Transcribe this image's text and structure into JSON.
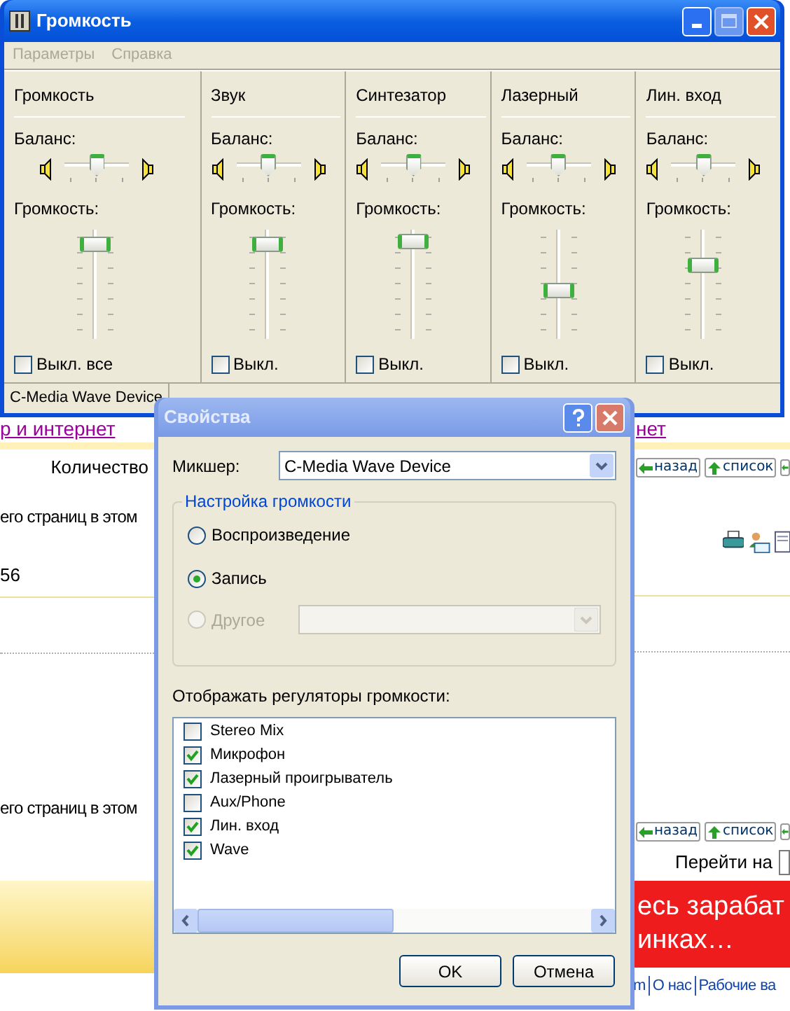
{
  "web_page": {
    "link_left": "р и интернет",
    "link_right": "нет",
    "count_label": "Количество",
    "pages_text_top": "его страниц в этом",
    "number": "56",
    "pages_text_bottom": "его страниц в этом",
    "nav_top": [
      "назад",
      "список"
    ],
    "nav_bottom": [
      "назад",
      "список"
    ],
    "goto_label": "Перейти на",
    "banner_lines": [
      "есь зарабат",
      "инках…"
    ],
    "footer_links": [
      "m",
      "О нас",
      "Рабочие ва"
    ]
  },
  "mixer_window": {
    "title": "Громкость",
    "menu": [
      "Параметры",
      "Справка"
    ],
    "channels": [
      {
        "name": "Громкость",
        "balance_label": "Баланс:",
        "balance": {
          "level": 0.5
        },
        "volume_label": "Громкость:",
        "volume": {
          "level": 0.93
        },
        "mute": {
          "label": "Выкл. все",
          "checked": false
        }
      },
      {
        "name": "Звук",
        "balance_label": "Баланс:",
        "balance": {
          "level": 0.5
        },
        "volume_label": "Громкость:",
        "volume": {
          "level": 0.93
        },
        "mute": {
          "label": "Выкл.",
          "checked": false
        }
      },
      {
        "name": "Синтезатор",
        "balance_label": "Баланс:",
        "balance": {
          "level": 0.5
        },
        "volume_label": "Громкость:",
        "volume": {
          "level": 0.96
        },
        "mute": {
          "label": "Выкл.",
          "checked": false
        }
      },
      {
        "name": "Лазерный",
        "balance_label": "Баланс:",
        "balance": {
          "level": 0.5
        },
        "volume_label": "Громкость:",
        "volume": {
          "level": 0.44
        },
        "mute": {
          "label": "Выкл.",
          "checked": false
        }
      },
      {
        "name": "Лин. вход",
        "balance_label": "Баланс:",
        "balance": {
          "level": 0.5
        },
        "volume_label": "Громкость:",
        "volume": {
          "level": 0.7
        },
        "mute": {
          "label": "Выкл.",
          "checked": false
        }
      }
    ],
    "status_bar": "C-Media Wave Device"
  },
  "properties_dialog": {
    "title": "Свойства",
    "mixer_label": "Микшер:",
    "mixer_value": "C-Media Wave Device",
    "group_title": "Настройка громкости",
    "modes": [
      {
        "kind": "radio",
        "label": "Воспроизведение",
        "selected": false,
        "disabled": false
      },
      {
        "kind": "radio",
        "label": "Запись",
        "selected": true,
        "disabled": false
      },
      {
        "kind": "radio_select",
        "label": "Другое",
        "selected": false,
        "disabled": true
      }
    ],
    "controls_label": "Отображать регуляторы громкости:",
    "controls": [
      {
        "label": "Stereo Mix",
        "checked": false
      },
      {
        "label": "Микрофон",
        "checked": true
      },
      {
        "label": "Лазерный проигрыватель",
        "checked": true
      },
      {
        "label": "Aux/Phone",
        "checked": false
      },
      {
        "label": "Лин. вход",
        "checked": true
      },
      {
        "label": "Wave",
        "checked": true
      }
    ],
    "buttons": [
      "OK",
      "Отмена"
    ]
  }
}
